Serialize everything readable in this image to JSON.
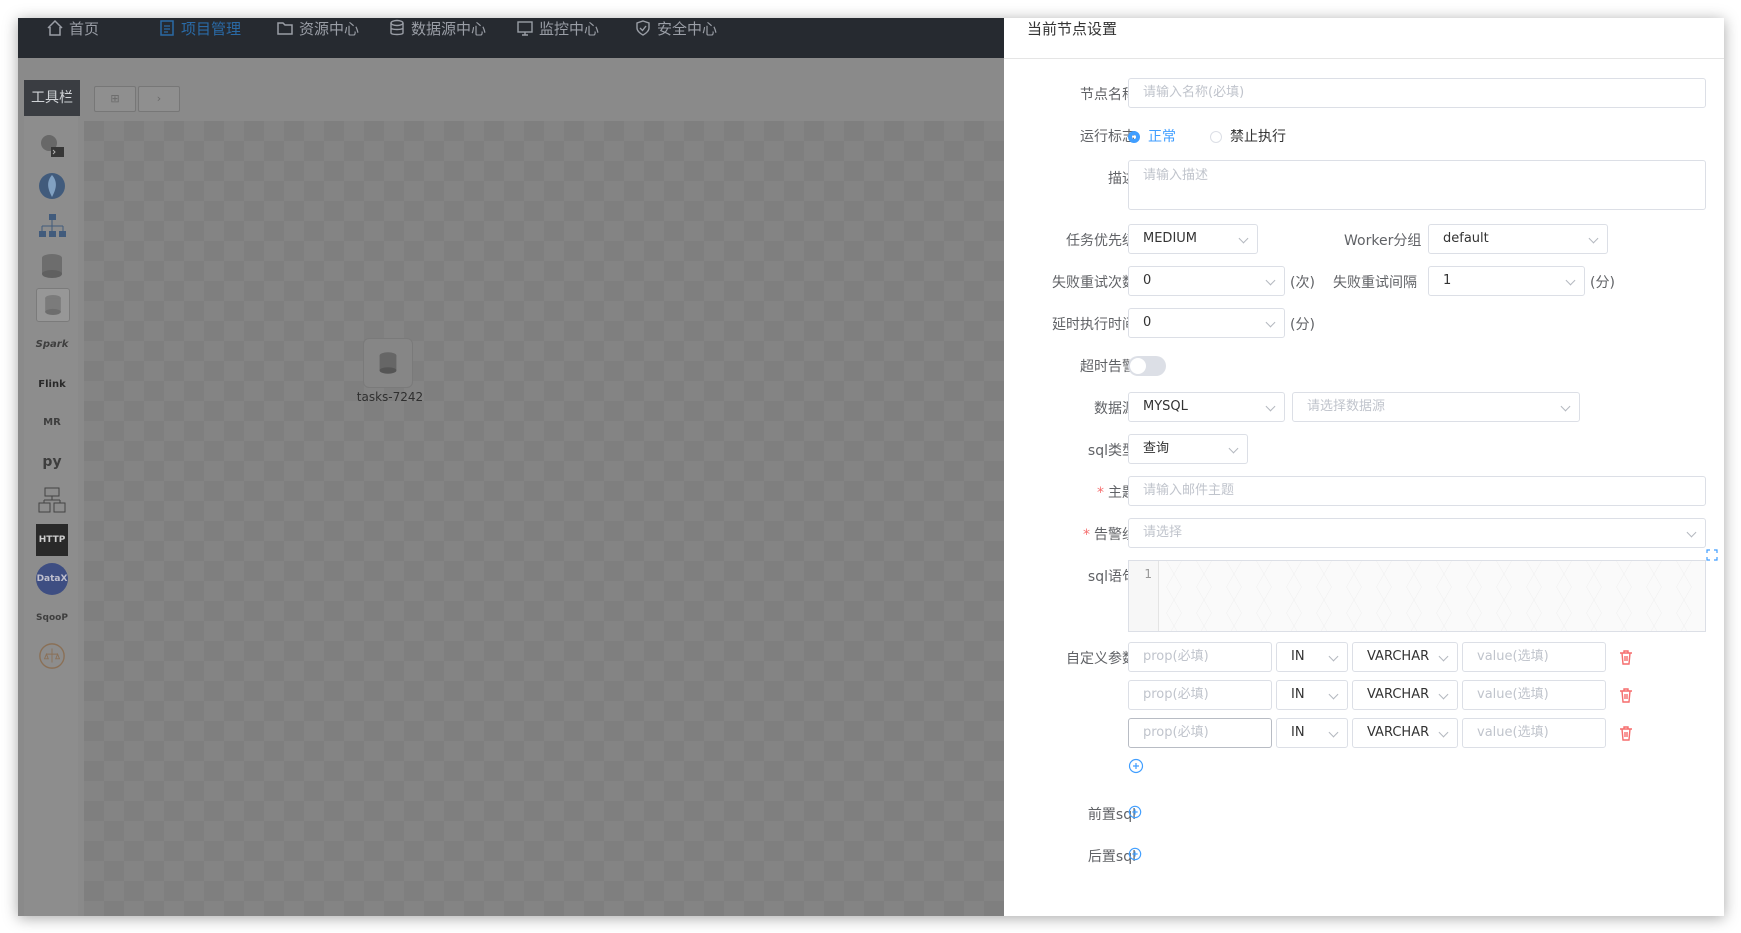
{
  "nav": {
    "items": [
      {
        "label": "首页",
        "icon": "home-icon"
      },
      {
        "label": "项目管理",
        "icon": "document-icon",
        "active": true
      },
      {
        "label": "资源中心",
        "icon": "folder-icon"
      },
      {
        "label": "数据源中心",
        "icon": "database-icon"
      },
      {
        "label": "监控中心",
        "icon": "monitor-icon"
      },
      {
        "label": "安全中心",
        "icon": "shield-icon"
      }
    ]
  },
  "toolbar": {
    "title": "工具栏",
    "tools": [
      {
        "name": "shell",
        "text": ""
      },
      {
        "name": "sub-process",
        "text": ""
      },
      {
        "name": "procedure",
        "text": ""
      },
      {
        "name": "sql",
        "text": ""
      },
      {
        "name": "selected-sql",
        "text": ""
      },
      {
        "name": "spark",
        "text": "Spark"
      },
      {
        "name": "flink",
        "text": "Flink"
      },
      {
        "name": "mr",
        "text": "MR"
      },
      {
        "name": "python",
        "text": "py"
      },
      {
        "name": "dependent",
        "text": ""
      },
      {
        "name": "http",
        "text": "HTTP"
      },
      {
        "name": "datax",
        "text": "DataX"
      },
      {
        "name": "sqoop",
        "text": "SqooP"
      },
      {
        "name": "conditions",
        "text": ""
      }
    ]
  },
  "canvas": {
    "node_label": "tasks-7242"
  },
  "drawer": {
    "title": "当前节点设置",
    "node_name_label": "节点名称",
    "node_name_placeholder": "请输入名称(必填)",
    "run_flag_label": "运行标志",
    "run_flag_normal": "正常",
    "run_flag_forbidden": "禁止执行",
    "description_label": "描述",
    "description_placeholder": "请输入描述",
    "priority_label": "任务优先级",
    "priority_value": "MEDIUM",
    "worker_group_label": "Worker分组",
    "worker_group_value": "default",
    "retry_times_label": "失败重试次数",
    "retry_times_value": "0",
    "retry_times_unit": "(次)",
    "retry_interval_label": "失败重试间隔",
    "retry_interval_value": "1",
    "retry_interval_unit": "(分)",
    "delay_label": "延时执行时间",
    "delay_value": "0",
    "delay_unit": "(分)",
    "timeout_label": "超时告警",
    "datasource_label": "数据源",
    "datasource_type": "MYSQL",
    "datasource_placeholder": "请选择数据源",
    "sql_type_label": "sql类型",
    "sql_type_value": "查询",
    "subject_label": "主题",
    "subject_placeholder": "请输入邮件主题",
    "alert_group_label": "告警组",
    "alert_group_placeholder": "请选择",
    "sql_label": "sql语句",
    "sql_line_number": "1",
    "custom_params_label": "自定义参数",
    "params": [
      {
        "prop_placeholder": "prop(必填)",
        "direction": "IN",
        "type": "VARCHAR",
        "value_placeholder": "value(选填)"
      },
      {
        "prop_placeholder": "prop(必填)",
        "direction": "IN",
        "type": "VARCHAR",
        "value_placeholder": "value(选填)"
      },
      {
        "prop_placeholder": "prop(必填)",
        "direction": "IN",
        "type": "VARCHAR",
        "value_placeholder": "value(选填)"
      }
    ],
    "pre_sql_label": "前置sql",
    "post_sql_label": "后置sql"
  },
  "colors": {
    "accent": "#409eff",
    "danger": "#f56c6c",
    "nav_bg": "#262a30"
  }
}
